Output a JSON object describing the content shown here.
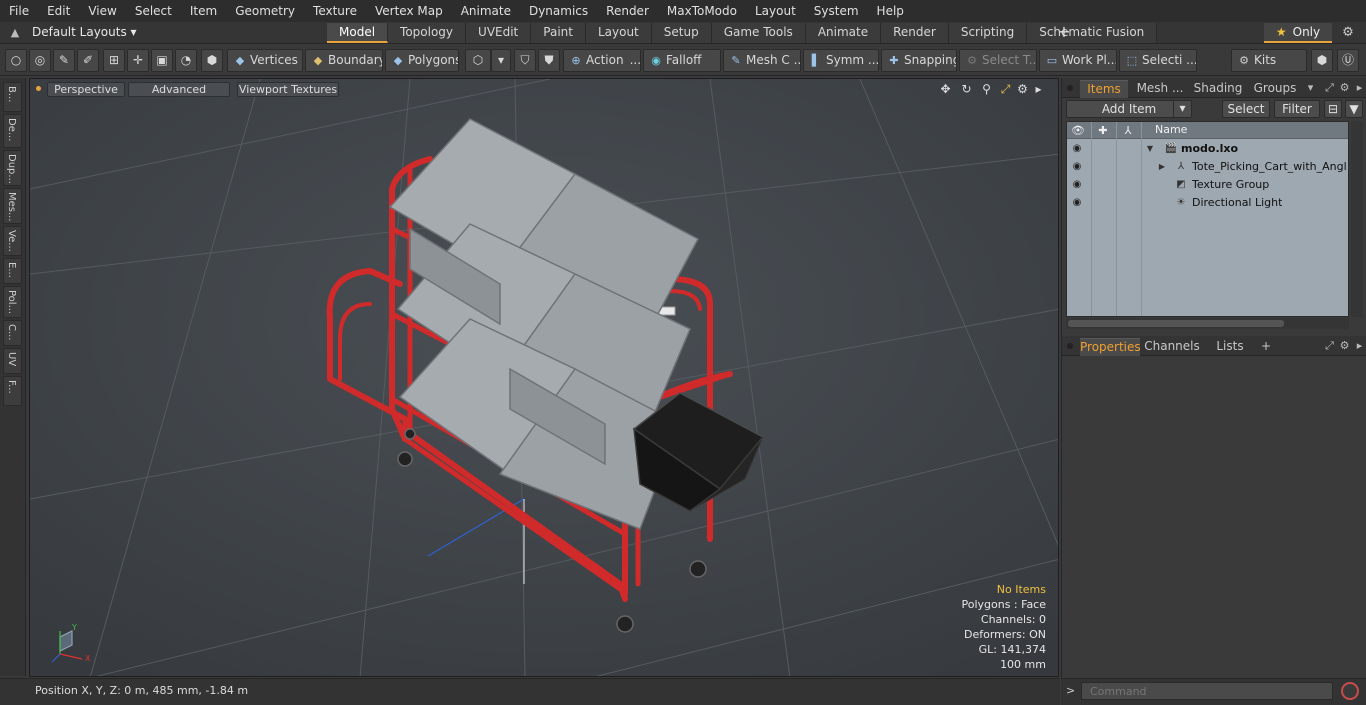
{
  "menubar": [
    "File",
    "Edit",
    "View",
    "Select",
    "Item",
    "Geometry",
    "Texture",
    "Vertex Map",
    "Animate",
    "Dynamics",
    "Render",
    "MaxToModo",
    "Layout",
    "System",
    "Help"
  ],
  "layoutbar": {
    "layout_name": "Default Layouts ▾",
    "tabs": [
      "Model",
      "Topology",
      "UVEdit",
      "Paint",
      "Layout",
      "Setup",
      "Game Tools",
      "Animate",
      "Render",
      "Scripting",
      "Schematic Fusion"
    ],
    "active_tab": "Model",
    "add_tab": "+",
    "only_label": "Only",
    "accent_color": "#e8a33c"
  },
  "toolbar": {
    "vertices": "Vertices",
    "boundary": "Boundary",
    "polygons": "Polygons",
    "action": "Action",
    "falloff": "Falloff",
    "mesh": "Mesh C ...",
    "symmetry": "Symm ...",
    "snapping": "Snapping",
    "select_t": "Select T...",
    "work_plane": "Work Pl...",
    "selection": "Selecti ...",
    "kits": "Kits",
    "dots": "..."
  },
  "lefttabs": [
    "B...",
    "De...",
    "Dup...",
    "Mes...",
    "Ve...",
    "E...",
    "Pol...",
    "C...",
    "UV",
    "F..."
  ],
  "viewport": {
    "view_mode": "Perspective",
    "shading": "Advanced",
    "textures": "Viewport Textures",
    "stats": {
      "selection": "No Items",
      "polygons": "Polygons : Face",
      "channels": "Channels: 0",
      "deformers": "Deformers: ON",
      "gl": "GL: 141,374",
      "unit": "100 mm"
    },
    "cart_color": "#d02a2a",
    "tote_color": "#a8adb2",
    "basket_color": "#1c1c1c"
  },
  "statusbar": {
    "position": "Position X, Y, Z:   0 m, 485 mm, -1.84 m"
  },
  "items_panel": {
    "tabs": [
      "Items",
      "Mesh ...",
      "Shading",
      "Groups"
    ],
    "active_tab": "Items",
    "add_item": "Add Item",
    "select": "Select",
    "filter": "Filter",
    "column_name": "Name",
    "items": [
      {
        "label": "modo.lxo",
        "icon": "scene-icon"
      },
      {
        "label": "Tote_Picking_Cart_with_Angl ...",
        "icon": "mesh-icon"
      },
      {
        "label": "Texture Group",
        "icon": "texture-group-icon"
      },
      {
        "label": "Directional Light",
        "icon": "light-icon"
      }
    ]
  },
  "properties_panel": {
    "tabs": [
      "Properties",
      "Channels",
      "Lists"
    ],
    "active_tab": "Properties",
    "add_tab": "+"
  },
  "command": {
    "prompt": ">",
    "placeholder": "Command"
  }
}
